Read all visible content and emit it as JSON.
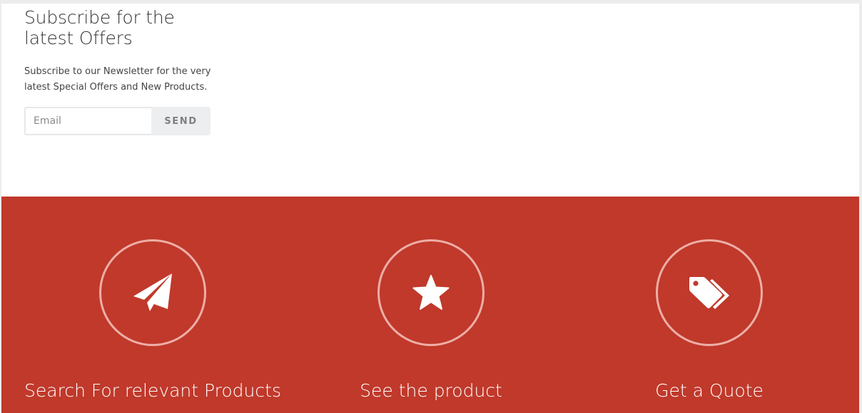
{
  "subscribe": {
    "title_line1": "Subscribe for the",
    "title_line2": "latest Offers",
    "description_line1": "Subscribe to our Newsletter for the very",
    "description_line2": "latest Special Offers and New Products.",
    "email_placeholder": "Email",
    "email_value": "",
    "send_label": "SEND"
  },
  "features": {
    "items": [
      {
        "icon": "paper-plane-icon",
        "title": "Search For relevant Products"
      },
      {
        "icon": "star-icon",
        "title": "See the product"
      },
      {
        "icon": "tags-icon",
        "title": "Get a Quote"
      }
    ]
  },
  "colors": {
    "feature_background": "#c0392b",
    "circle_border": "#eeaea7",
    "button_background": "#eceef0",
    "page_background": "#ffffff"
  }
}
